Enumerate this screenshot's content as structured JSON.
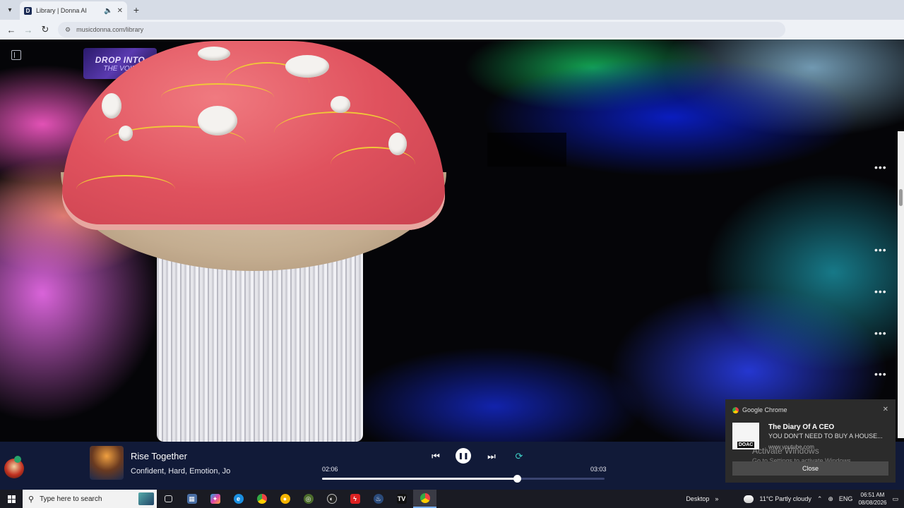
{
  "browser": {
    "tab_title": "Library | Donna AI",
    "favicon_letter": "D",
    "url": "musicdonna.com/library"
  },
  "page": {
    "playlist_art_line1": "DROP INTO",
    "playlist_art_line2": "THE VOID",
    "more_label": "•••"
  },
  "player": {
    "track_title": "Rise Together",
    "track_tags": "Confident, Hard, Emotion, Jo",
    "elapsed": "02:06",
    "duration": "03:03",
    "progress_fraction": 0.69
  },
  "notification": {
    "app_name": "Google Chrome",
    "title": "The Diary Of A CEO",
    "body": "YOU DON'T NEED TO BUY A HOUSE...",
    "source": "www.youtube.com",
    "thumb_label": "DOAC",
    "button_label": "Close",
    "watermark_title": "Activate Windows",
    "watermark_sub": "Go to Settings to activate Windows."
  },
  "taskbar": {
    "search_placeholder": "Type here to search",
    "desktop_label": "Desktop",
    "weather": "11°C  Partly cloudy",
    "language": "ENG",
    "time": "06:51 AM",
    "date": "08/08/2026"
  },
  "colors": {
    "player_bg": "#111a38",
    "taskbar_bg": "#1a1b23",
    "accent_blue": "#7ab0ff"
  },
  "icons": [
    "tab-list-icon",
    "speaker-icon",
    "close-icon",
    "plus-icon",
    "back-icon",
    "forward-icon",
    "reload-icon",
    "site-info-icon",
    "sidebar-toggle-icon",
    "more-icon",
    "previous-icon",
    "pause-icon",
    "next-icon",
    "repeat-icon",
    "windows-icon",
    "search-icon",
    "weather-icon",
    "notification-icon"
  ]
}
